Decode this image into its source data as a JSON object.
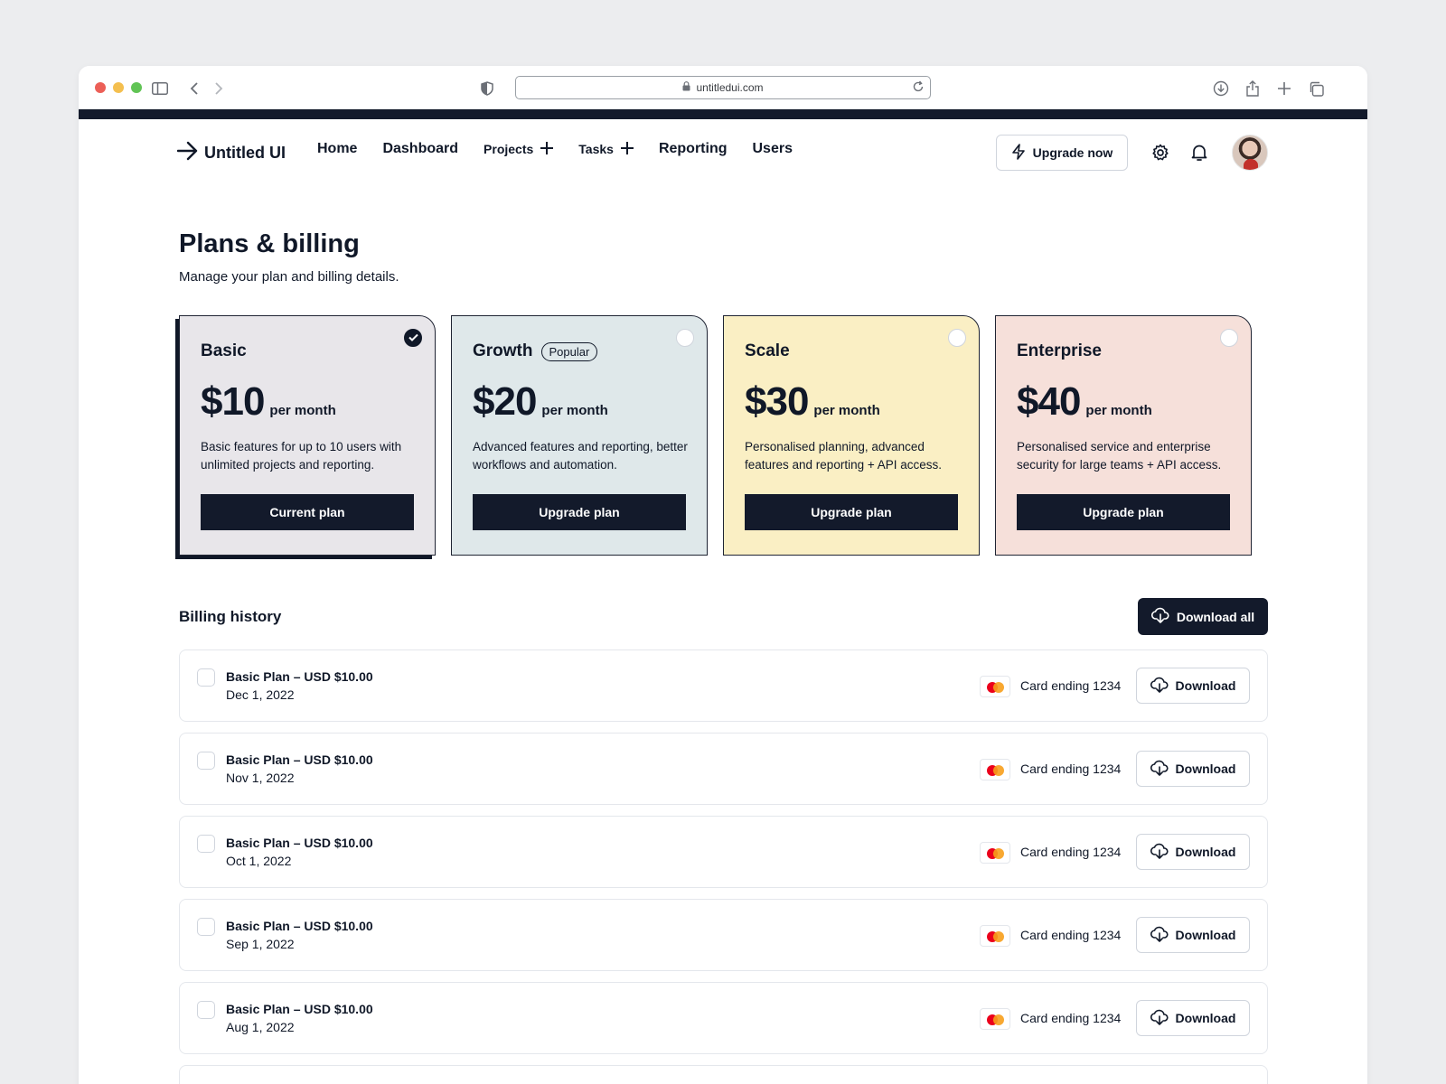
{
  "browser": {
    "url": "untitledui.com"
  },
  "nav": {
    "brand": "Untitled UI",
    "links": [
      "Home",
      "Dashboard",
      "Projects",
      "Tasks",
      "Reporting",
      "Users"
    ],
    "upgrade_label": "Upgrade now"
  },
  "header": {
    "title": "Plans & billing",
    "subtitle": "Manage your plan and billing details."
  },
  "plans": [
    {
      "name": "Basic",
      "price": "$10",
      "period": "per month",
      "description": "Basic features for up to 10 users with unlimited projects and reporting.",
      "button": "Current plan",
      "selected": true,
      "color": "#e8e6ea"
    },
    {
      "name": "Growth",
      "badge": "Popular",
      "price": "$20",
      "period": "per month",
      "description": "Advanced features and reporting, better workflows and automation.",
      "button": "Upgrade plan",
      "selected": false,
      "color": "#dfe8ea"
    },
    {
      "name": "Scale",
      "price": "$30",
      "period": "per month",
      "description": "Personalised planning, advanced features and reporting + API access.",
      "button": "Upgrade plan",
      "selected": false,
      "color": "#faefc4"
    },
    {
      "name": "Enterprise",
      "price": "$40",
      "period": "per month",
      "description": "Personalised service and enterprise security for large teams + API access.",
      "button": "Upgrade plan",
      "selected": false,
      "color": "#f6e0da"
    }
  ],
  "billing": {
    "title": "Billing history",
    "download_all_label": "Download all",
    "rows": [
      {
        "title": "Basic Plan – USD $10.00",
        "date": "Dec 1, 2022",
        "card": "Card ending 1234",
        "action": "Download"
      },
      {
        "title": "Basic Plan – USD $10.00",
        "date": "Nov 1, 2022",
        "card": "Card ending 1234",
        "action": "Download"
      },
      {
        "title": "Basic Plan – USD $10.00",
        "date": "Oct 1, 2022",
        "card": "Card ending 1234",
        "action": "Download"
      },
      {
        "title": "Basic Plan – USD $10.00",
        "date": "Sep 1, 2022",
        "card": "Card ending 1234",
        "action": "Download"
      },
      {
        "title": "Basic Plan – USD $10.00",
        "date": "Aug 1, 2022",
        "card": "Card ending 1234",
        "action": "Download"
      }
    ]
  },
  "colors": {
    "dark": "#131a2b",
    "border": "#d0d5dd",
    "traffic_red": "#ec5f57",
    "traffic_yellow": "#f4bf4f",
    "traffic_green": "#61c455"
  },
  "icons": [
    "sidebar-toggle-icon",
    "back-icon",
    "forward-icon",
    "shield-icon",
    "lock-icon",
    "reload-icon",
    "download-icon",
    "share-icon",
    "new-tab-icon",
    "tabs-icon",
    "arrow-right-logo-icon",
    "plus-icon",
    "lightning-icon",
    "gear-icon",
    "bell-icon",
    "check-icon",
    "download-cloud-icon",
    "mastercard-icon"
  ]
}
